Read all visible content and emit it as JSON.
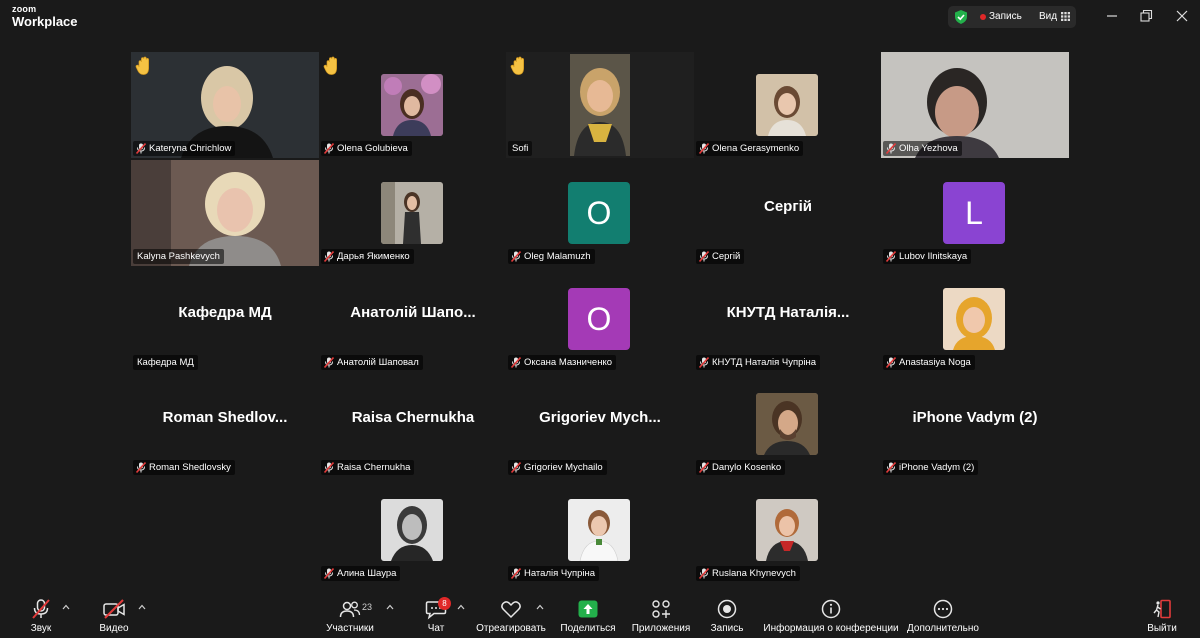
{
  "app": {
    "brand_small": "zoom",
    "brand_large": "Workplace"
  },
  "titlebar": {
    "record_label": "Запись",
    "view_label": "Вид"
  },
  "colors": {
    "active_speaker": "#23d18b",
    "record": "#e02828",
    "avatar_teal": "#127e70",
    "avatar_magenta": "#a43ab6",
    "avatar_purple": "#8a44d2"
  },
  "participants": [
    {
      "name": "Kateryna Chrichlow"
    },
    {
      "name": "Olena Golubieva"
    },
    {
      "name": "Sofi"
    },
    {
      "name": "Olena Gerasymenko"
    },
    {
      "name": "Olha Yezhova"
    },
    {
      "name": "Kalyna Pashkevych"
    },
    {
      "name": "Дарья Якименко"
    },
    {
      "name": "Oleg Malamuzh",
      "avatar_letter": "O"
    },
    {
      "name": "Сергій",
      "display": "Сергій"
    },
    {
      "name": "Lubov Ilnitskaya",
      "avatar_letter": "L"
    },
    {
      "name": "Кафедра МД",
      "display": "Кафедра МД"
    },
    {
      "name": "Анатолій Шаповал",
      "display": "Анатолій  Шапо..."
    },
    {
      "name": "Оксана Мазниченко",
      "avatar_letter": "O"
    },
    {
      "name": "КНУТД Наталія Чупріна",
      "display": "КНУТД  Наталія..."
    },
    {
      "name": "Anastasiya Noga"
    },
    {
      "name": "Roman Shedlovsky",
      "display": "Roman  Shedlov..."
    },
    {
      "name": "Raisa Chernukha",
      "display": "Raisa Chernukha"
    },
    {
      "name": "Grigoriev Mychailo",
      "display": "Grigoriev  Mych..."
    },
    {
      "name": "Danylo Kosenko"
    },
    {
      "name": "iPhone Vadym (2)",
      "display": "iPhone Vadym (2)"
    },
    {
      "name": "Алина Шаура"
    },
    {
      "name": "Наталія Чупріна"
    },
    {
      "name": "Ruslana Khynevych"
    }
  ],
  "toolbar": {
    "audio_label": "Звук",
    "video_label": "Видео",
    "participants_label": "Участники",
    "participants_count": "23",
    "chat_label": "Чат",
    "chat_badge": "8",
    "react_label": "Отреагировать",
    "share_label": "Поделиться",
    "apps_label": "Приложения",
    "record_label": "Запись",
    "info_label": "Информация о конференции",
    "more_label": "Дополнительно",
    "leave_label": "Выйти"
  }
}
